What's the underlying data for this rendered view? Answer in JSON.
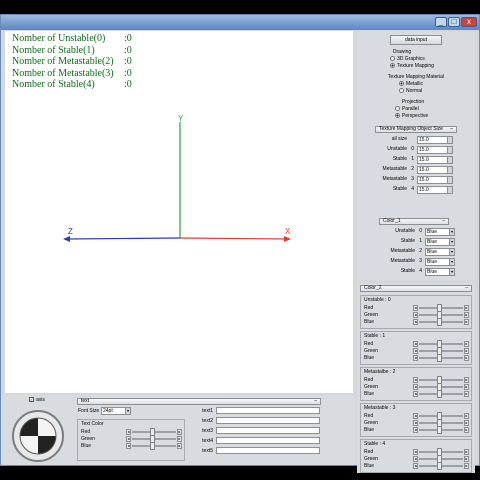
{
  "window": {
    "minimize": "_",
    "maximize": "□",
    "close": "x"
  },
  "stats": [
    {
      "label": "Nomber of Unstable(0)",
      "value": ":0"
    },
    {
      "label": "Nomber of Stable(1)",
      "value": ":0"
    },
    {
      "label": "Nomber of Metastable(2)",
      "value": ":0"
    },
    {
      "label": "Nomber of Metastable(3)",
      "value": ":0"
    },
    {
      "label": "Nomber of Stable(4)",
      "value": ":0"
    }
  ],
  "axes": {
    "x": "X",
    "y": "Y",
    "z": "Z",
    "colors": {
      "x": "#e33a2a",
      "y": "#2aa33a",
      "z": "#2a3ac8"
    }
  },
  "panel": {
    "data_input": "data input",
    "drawing": {
      "title": "Drawing",
      "options": [
        "3D Graphics",
        "Texture Mapping"
      ],
      "selected": "Texture Mapping"
    },
    "material": {
      "title": "Texture Mapping Material",
      "options": [
        "Metallic",
        "Normal"
      ],
      "selected": "Metallic"
    },
    "projection": {
      "title": "Projection",
      "options": [
        "Parallel",
        "Perspective"
      ],
      "selected": "Perspective"
    },
    "size_group": {
      "title": "Texture Mapping Object Size",
      "all_label": "all size",
      "all_value": "15.0",
      "rows": [
        {
          "label": "Unstable",
          "idx": "0",
          "value": "15.0"
        },
        {
          "label": "Stable",
          "idx": "1",
          "value": "15.0"
        },
        {
          "label": "Metastable",
          "idx": "2",
          "value": "15.0"
        },
        {
          "label": "Metastable",
          "idx": "3",
          "value": "15.0"
        },
        {
          "label": "Stable",
          "idx": "4",
          "value": "15.0"
        }
      ]
    },
    "color1": {
      "title": "Color_1",
      "rows": [
        {
          "label": "Unstable",
          "idx": "0",
          "value": "Blue"
        },
        {
          "label": "Stable",
          "idx": "1",
          "value": "Blue"
        },
        {
          "label": "Metastable",
          "idx": "2",
          "value": "Blue"
        },
        {
          "label": "Metastable",
          "idx": "3",
          "value": "Blue"
        },
        {
          "label": "Stable",
          "idx": "4",
          "value": "Blue"
        }
      ]
    },
    "color2": {
      "title": "Color_2",
      "channels": [
        "Red",
        "Green",
        "Blue"
      ],
      "groups": [
        {
          "title": "Unstable : 0",
          "levels": [
            0.45,
            0.45,
            0.45
          ]
        },
        {
          "title": "Stable : 1",
          "levels": [
            0.45,
            0.45,
            0.45
          ]
        },
        {
          "title": "Metastalbe : 2",
          "levels": [
            0.45,
            0.45,
            0.45
          ]
        },
        {
          "title": "Metastable : 3",
          "levels": [
            0.45,
            0.45,
            0.45
          ]
        },
        {
          "title": "Stable : 4",
          "levels": [
            0.45,
            0.45,
            0.45
          ]
        }
      ]
    }
  },
  "bottom": {
    "axis_checkbox": "axis",
    "rotation": "Rotation",
    "text_title": "text",
    "font_size_label": "Font Size",
    "font_size_value": "24pt",
    "text_color": {
      "title": "Text Color",
      "channels": [
        "Red",
        "Green",
        "Blue"
      ],
      "levels": [
        0.45,
        0.45,
        0.45
      ]
    },
    "text_fields": [
      {
        "label": "text1",
        "value": ""
      },
      {
        "label": "text2",
        "value": ""
      },
      {
        "label": "text3",
        "value": ""
      },
      {
        "label": "text4",
        "value": ""
      },
      {
        "label": "text5",
        "value": ""
      }
    ]
  }
}
